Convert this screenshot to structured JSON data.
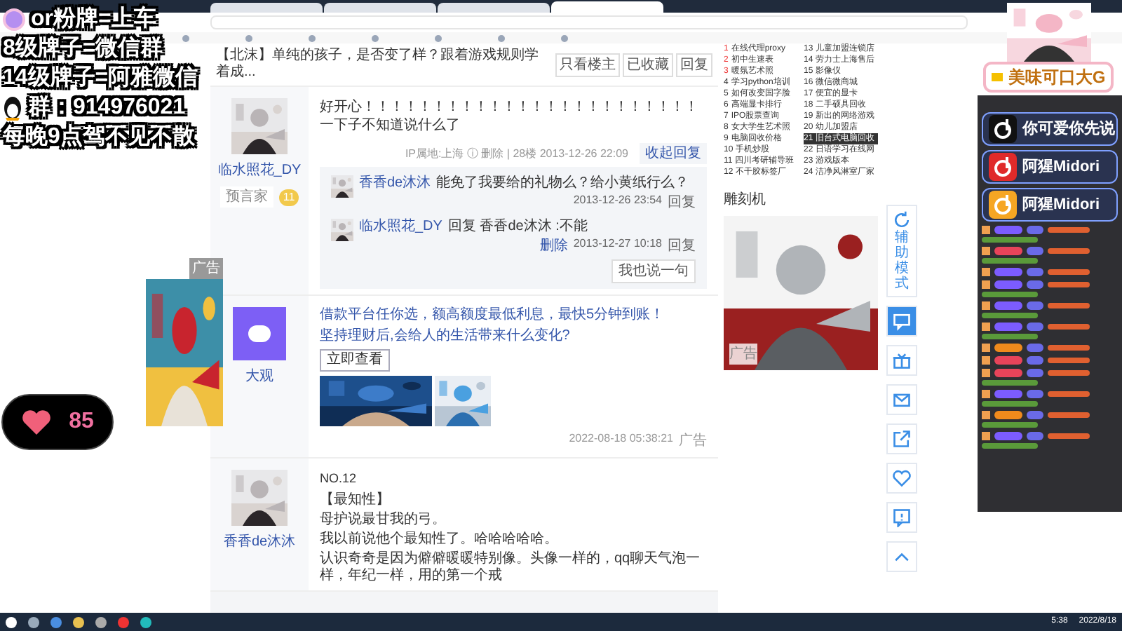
{
  "browser": {
    "tabs": [
      {
        "selected": false
      },
      {
        "selected": false
      },
      {
        "selected": false
      },
      {
        "selected": true
      }
    ]
  },
  "overlay": {
    "lines": [
      {
        "kind": "logo",
        "text": "or粉牌=上车"
      },
      {
        "kind": "plain",
        "text": "8级牌子=微信群"
      },
      {
        "kind": "plain",
        "text": "14级牌子=阿雅微信"
      },
      {
        "kind": "qq",
        "text": "群：914976021"
      },
      {
        "kind": "plain",
        "text": "每晚9点驾不见不散"
      }
    ],
    "heart_count": "85",
    "ad_label": "广告"
  },
  "thread": {
    "title": "【北沫】单纯的孩子，是否变了样？跟着游戏规则学着成...",
    "actions": [
      "只看楼主",
      "已收藏",
      "回复"
    ],
    "posts": [
      {
        "kind": "post",
        "user": "临水照花_DY",
        "badge": "预言家",
        "badge_level": "11",
        "text": "好开心！！！！！！！！！！！！！！！！！！！！！！！！一下子不知道说什么了",
        "meta": "IP属地:上海 ⓘ 删除 | 28楼 2013-12-26 22:09",
        "collapse": "收起回复",
        "replies": [
          {
            "user": "香香de沐沐",
            "text": "能免了我要给的礼物么？给小黄纸行么？",
            "time": "2013-12-26 23:54",
            "action": "回复"
          },
          {
            "user": "临水照花_DY",
            "text": "回复 香香de沐沐 :不能",
            "time": "2013-12-27 10:18",
            "action": "回复",
            "delete": "删除"
          }
        ],
        "say": "我也说一句"
      },
      {
        "kind": "ad",
        "user": "大观",
        "headline": "借款平台任你选，额高额度最低利息，最快5分钟到账！",
        "sub": "坚持理财后,会给人的生活带来什么变化?",
        "button": "立即查看",
        "time": "2022-08-18 05:38:21",
        "ad": "广告"
      },
      {
        "kind": "post",
        "user": "香香de沐沐",
        "floor": "NO.12",
        "lines": [
          "【最知性】",
          "母护说最甘我的弓。",
          "我以前说他个最知性了。哈哈哈哈哈。",
          "认识奇奇是因为僻僻暖暖特别像。头像一样的，qq聊天气泡一样，年纪一样，用的第一个戒"
        ]
      }
    ]
  },
  "hot": {
    "items": [
      {
        "rank": "1",
        "text": "在线代理proxy",
        "selected": false
      },
      {
        "rank": "2",
        "text": "初中生速表",
        "selected": false
      },
      {
        "rank": "3",
        "text": "暖氛艺术照",
        "selected": false
      },
      {
        "rank": "4",
        "text": "学习python培训",
        "selected": false
      },
      {
        "rank": "5",
        "text": "如何改变国字脸",
        "selected": false
      },
      {
        "rank": "6",
        "text": "高端显卡排行",
        "selected": false
      },
      {
        "rank": "7",
        "text": "IPO股票查询",
        "selected": false
      },
      {
        "rank": "8",
        "text": "女大学生艺术照",
        "selected": false
      },
      {
        "rank": "9",
        "text": "电脑回收价格",
        "selected": false
      },
      {
        "rank": "10",
        "text": "手机炒股",
        "selected": false
      },
      {
        "rank": "11",
        "text": "四川考研辅导班",
        "selected": false
      },
      {
        "rank": "12",
        "text": "不干胶标签厂",
        "selected": false
      },
      {
        "rank": "13",
        "text": "儿童加盟连锁店",
        "selected": false
      },
      {
        "rank": "14",
        "text": "劳力士上海售后",
        "selected": false
      },
      {
        "rank": "15",
        "text": "影像仪",
        "selected": false
      },
      {
        "rank": "16",
        "text": "微信微商城",
        "selected": false
      },
      {
        "rank": "17",
        "text": "便宜的显卡",
        "selected": false
      },
      {
        "rank": "18",
        "text": "二手硕具回收",
        "selected": false
      },
      {
        "rank": "19",
        "text": "新出的网络游戏",
        "selected": false
      },
      {
        "rank": "20",
        "text": "幼儿加盟店",
        "selected": false
      },
      {
        "rank": "21",
        "text": "旧台式电脑回收",
        "selected": true
      },
      {
        "rank": "22",
        "text": "日语学习在线网",
        "selected": false
      },
      {
        "rank": "23",
        "text": "游戏版本",
        "selected": false
      },
      {
        "rank": "24",
        "text": "洁净风淋室厂家",
        "selected": false
      }
    ],
    "ad_title": "雕刻机",
    "ad_label": "广告"
  },
  "tools": [
    {
      "kind": "refresh",
      "label": "辅助模式"
    },
    {
      "kind": "chat"
    },
    {
      "kind": "gift"
    },
    {
      "kind": "mail"
    },
    {
      "kind": "share"
    },
    {
      "kind": "heart"
    },
    {
      "kind": "alert"
    },
    {
      "kind": "top"
    }
  ],
  "stream": {
    "banner": "美味可口大G",
    "socials": [
      {
        "kind": "tiktok",
        "text": "你可爱你先说"
      },
      {
        "kind": "netease",
        "text": "阿猩Midori"
      },
      {
        "kind": "weibo",
        "text": "阿猩Midori"
      }
    ],
    "chat": [
      {
        "color": "#7c5cff",
        "kind": "long"
      },
      {
        "color": "#e8445a",
        "kind": "long"
      },
      {
        "color": "#7c5cff",
        "kind": "short"
      },
      {
        "color": "#7c5cff",
        "kind": "long"
      },
      {
        "color": "#7c5cff",
        "kind": "long"
      },
      {
        "color": "#7c5cff",
        "kind": "long"
      },
      {
        "color": "#f08a1c",
        "kind": "short"
      },
      {
        "color": "#e8445a",
        "kind": "short"
      },
      {
        "color": "#e8445a",
        "kind": "long"
      },
      {
        "color": "#7c5cff",
        "kind": "long"
      },
      {
        "color": "#f08a1c",
        "kind": "long"
      },
      {
        "color": "#7c5cff",
        "kind": "long"
      }
    ]
  },
  "taskbar": {
    "time": "5:38",
    "date": "2022/8/18"
  }
}
